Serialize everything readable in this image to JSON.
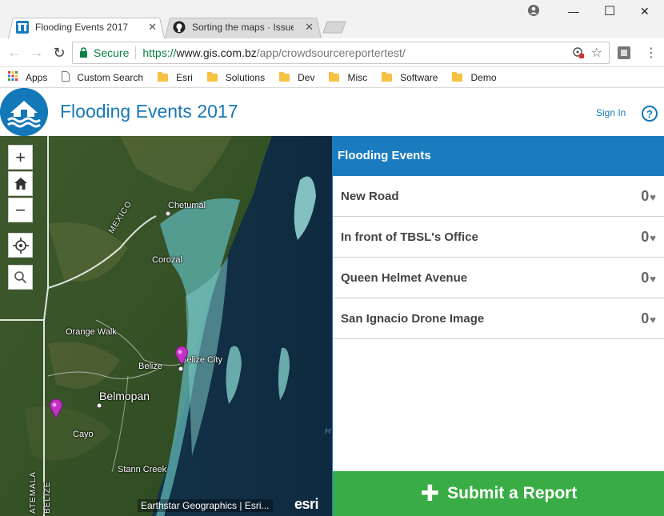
{
  "browser": {
    "tabs": [
      {
        "title": "Flooding Events 2017",
        "active": true
      },
      {
        "title": "Sorting the maps · Issue",
        "active": false
      }
    ],
    "address": {
      "secure_label": "Secure",
      "protocol": "https://",
      "host": "www.gis.com.bz",
      "path": "/app/crowdsourcereportertest/"
    },
    "bookmarks": [
      "Apps",
      "Custom Search",
      "Esri",
      "Solutions",
      "Dev",
      "Misc",
      "Software",
      "Demo"
    ]
  },
  "app": {
    "title": "Flooding Events 2017",
    "sign_in": "Sign In",
    "help": "?"
  },
  "map": {
    "labels": {
      "chetumal": "Chetumal",
      "mexico": "MEXICO",
      "corozal": "Corozal",
      "orange_walk": "Orange Walk",
      "belize": "Belize",
      "belize_city": "Belize City",
      "belmopan": "Belmopan",
      "cayo": "Cayo",
      "stann_creek": "Stann Creek",
      "guatemala": "ATEMALA",
      "belize_vertical": "BELIZE",
      "ocean_hint": "H"
    },
    "attribution": "Earthstar Geographics | Esri...",
    "esri_logo": "esri"
  },
  "panel": {
    "heading": "Flooding Events",
    "events": [
      {
        "name": "New Road",
        "votes": "0"
      },
      {
        "name": "In front of TBSL's Office",
        "votes": "0"
      },
      {
        "name": "Queen Helmet Avenue",
        "votes": "0"
      },
      {
        "name": "San Ignacio Drone Image",
        "votes": "0"
      }
    ],
    "submit_label": "Submit a Report"
  },
  "colors": {
    "brand_blue": "#1a7bbf",
    "submit_green": "#3aac45",
    "secure_green": "#0b8043"
  }
}
